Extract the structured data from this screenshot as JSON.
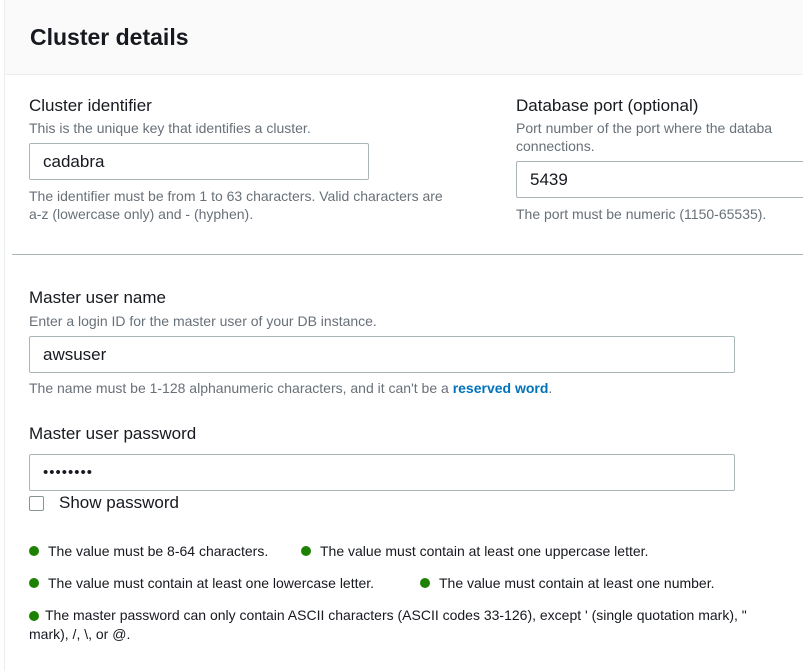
{
  "panel": {
    "title": "Cluster details"
  },
  "cluster_identifier": {
    "label": "Cluster identifier",
    "description": "This is the unique key that identifies a cluster.",
    "value": "cadabra",
    "help_line1": "The identifier must be from 1 to 63 characters. Valid characters are",
    "help_line2": "a-z (lowercase only) and - (hyphen)."
  },
  "database_port": {
    "label": "Database port (optional)",
    "description_line1": "Port number of the port where the databa",
    "description_line2": "connections.",
    "value": "5439",
    "help": "The port must be numeric (1150-65535)."
  },
  "master_user_name": {
    "label": "Master user name",
    "description": "Enter a login ID for the master user of your DB instance.",
    "value": "awsuser",
    "help_prefix": "The name must be 1-128 alphanumeric characters, and it can't be a ",
    "help_link": "reserved word",
    "help_suffix": "."
  },
  "master_user_password": {
    "label": "Master user password",
    "value": "••••••••",
    "show_password_label": "Show password",
    "show_password_checked": false
  },
  "password_rules": {
    "status_color": "#1d8102",
    "rule1": "The value must be 8-64 characters.",
    "rule2": "The value must contain at least one uppercase letter.",
    "rule3": "The value must contain at least one lowercase letter.",
    "rule4": "The value must contain at least one number.",
    "rule5_line1": "The master password can only contain ASCII characters (ASCII codes 33-126), except ' (single quotation mark), \"",
    "rule5_line2": "mark), /, \\, or @."
  }
}
